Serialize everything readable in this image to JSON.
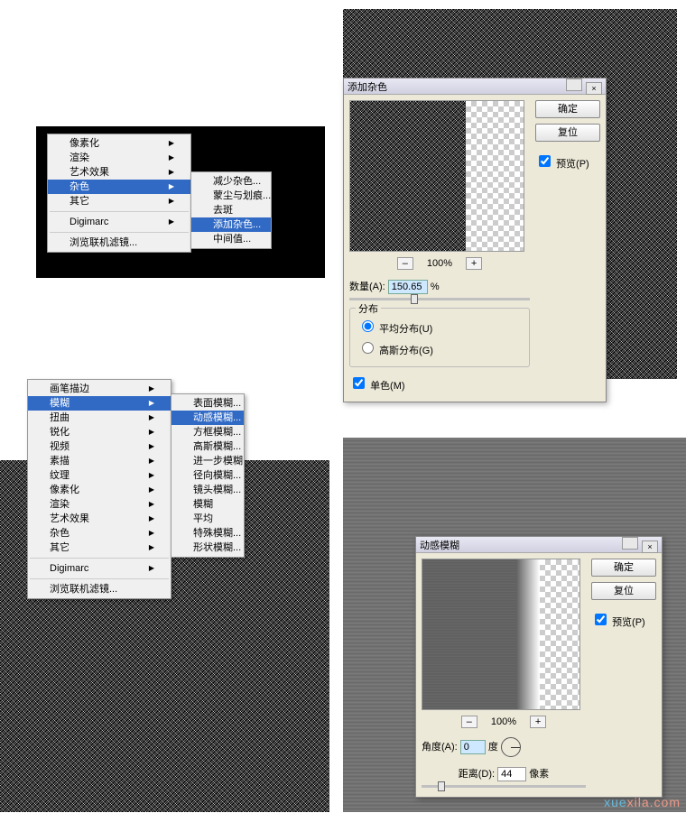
{
  "watermark": {
    "prefix": "xue",
    "suffix": "xila.com"
  },
  "menu1": {
    "items": [
      {
        "label": "像素化",
        "arrow": true
      },
      {
        "label": "渲染",
        "arrow": true
      },
      {
        "label": "艺术效果",
        "arrow": true
      },
      {
        "label": "杂色",
        "arrow": true,
        "selected": true
      },
      {
        "label": "其它",
        "arrow": true
      }
    ],
    "digimarc": "Digimarc",
    "browse": "浏览联机滤镜...",
    "sub": [
      {
        "label": "减少杂色..."
      },
      {
        "label": "蒙尘与划痕..."
      },
      {
        "label": "去斑"
      },
      {
        "label": "添加杂色...",
        "selected": true
      },
      {
        "label": "中间值..."
      }
    ]
  },
  "menu2": {
    "items": [
      {
        "label": "画笔描边",
        "arrow": true
      },
      {
        "label": "模糊",
        "arrow": true,
        "selected": true
      },
      {
        "label": "扭曲",
        "arrow": true
      },
      {
        "label": "锐化",
        "arrow": true
      },
      {
        "label": "视频",
        "arrow": true
      },
      {
        "label": "素描",
        "arrow": true
      },
      {
        "label": "纹理",
        "arrow": true
      },
      {
        "label": "像素化",
        "arrow": true
      },
      {
        "label": "渲染",
        "arrow": true
      },
      {
        "label": "艺术效果",
        "arrow": true
      },
      {
        "label": "杂色",
        "arrow": true
      },
      {
        "label": "其它",
        "arrow": true
      }
    ],
    "digimarc": "Digimarc",
    "browse": "浏览联机滤镜...",
    "sub": [
      {
        "label": "表面模糊..."
      },
      {
        "label": "动感模糊...",
        "selected": true
      },
      {
        "label": "方框模糊..."
      },
      {
        "label": "高斯模糊..."
      },
      {
        "label": "进一步模糊"
      },
      {
        "label": "径向模糊..."
      },
      {
        "label": "镜头模糊..."
      },
      {
        "label": "模糊"
      },
      {
        "label": "平均"
      },
      {
        "label": "特殊模糊..."
      },
      {
        "label": "形状模糊..."
      }
    ]
  },
  "addNoise": {
    "title": "添加杂色",
    "ok": "确定",
    "cancel": "复位",
    "preview": "预览(P)",
    "zoom_minus": "–",
    "zoom_plus": "+",
    "zoom": "100%",
    "amount_label": "数量(A):",
    "amount_value": "150.65",
    "amount_unit": "%",
    "dist_legend": "分布",
    "uniform": "平均分布(U)",
    "gaussian": "高斯分布(G)",
    "mono": "单色(M)"
  },
  "motionBlur": {
    "title": "动感模糊",
    "ok": "确定",
    "cancel": "复位",
    "preview": "预览(P)",
    "zoom_minus": "–",
    "zoom_plus": "+",
    "zoom": "100%",
    "angle_label": "角度(A):",
    "angle_value": "0",
    "angle_unit": "度",
    "distance_label": "距离(D):",
    "distance_value": "44",
    "distance_unit": "像素"
  }
}
